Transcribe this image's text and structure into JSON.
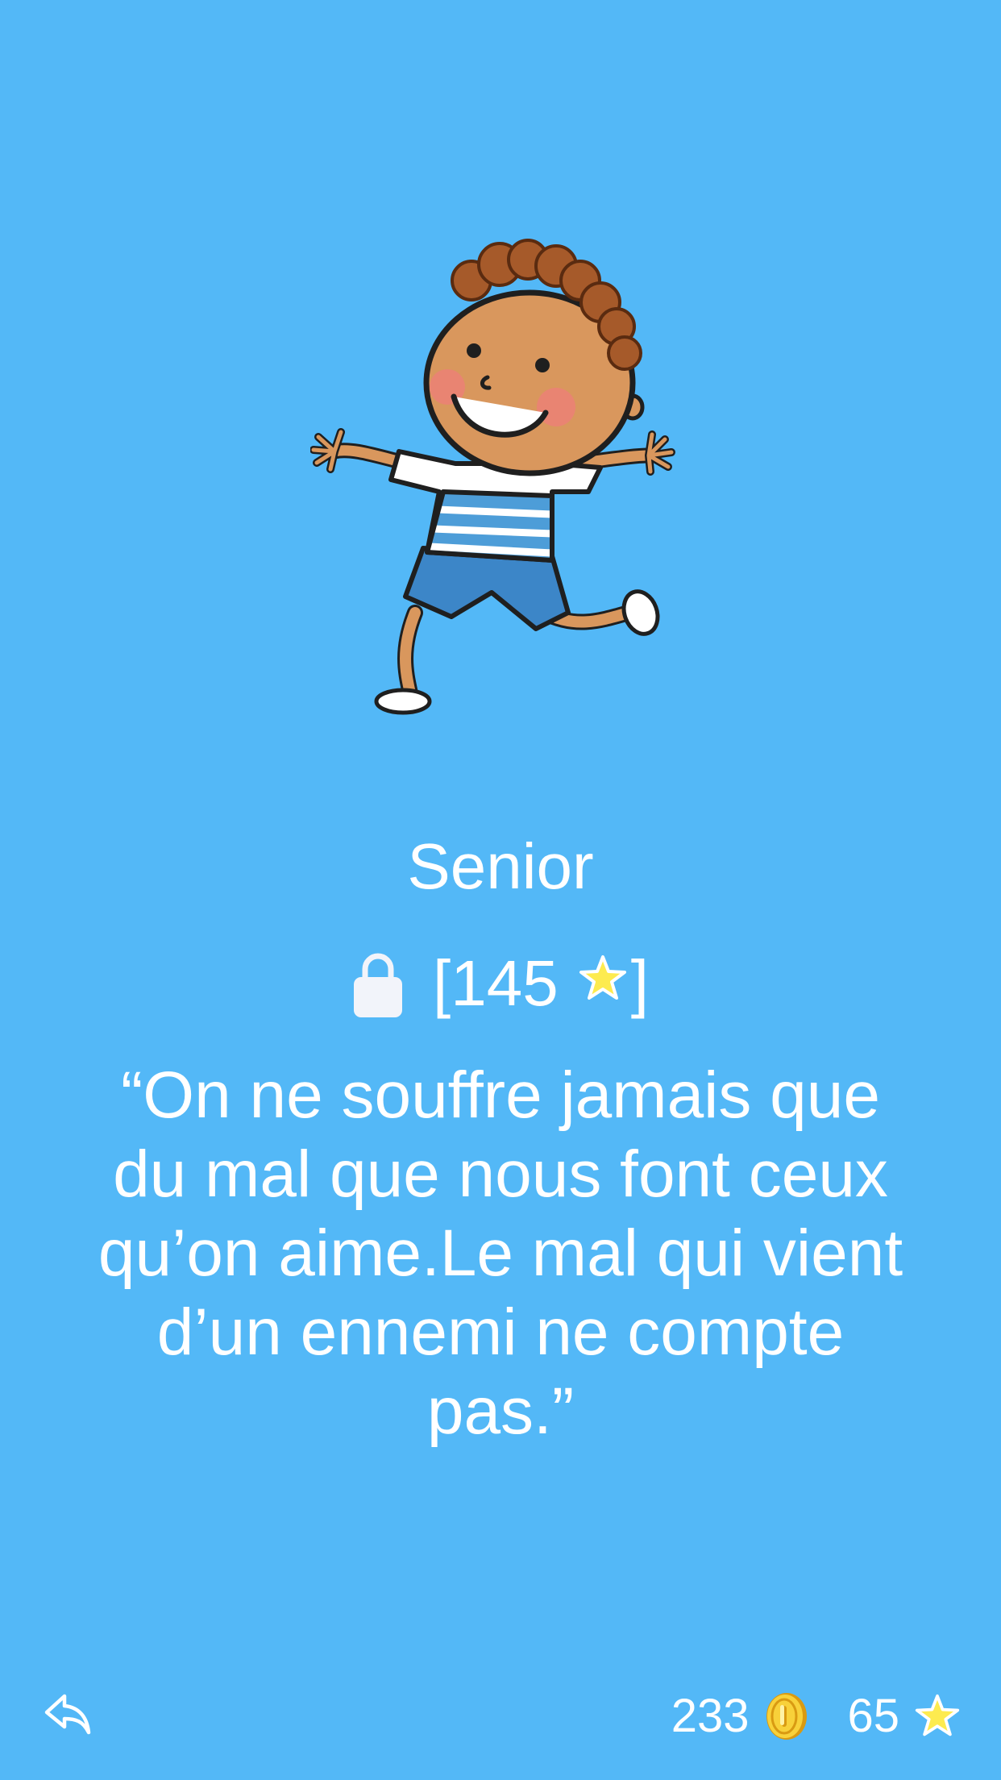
{
  "character": {
    "image": "running-boy-illustration",
    "title": "Senior"
  },
  "unlock": {
    "lock_icon": "lock-icon",
    "prefix": "[",
    "required": "145",
    "star_icon": "star-icon",
    "suffix": "]"
  },
  "quote": {
    "text": "“On ne souffre jamais que du mal que nous font ceux qu’on aime.Le mal qui vient d’un ennemi ne compte pas.”"
  },
  "footer": {
    "back_icon": "reply-arrow-icon",
    "coins": "233",
    "coin_icon": "gold-coin-icon",
    "stars": "65",
    "stars_icon": "star-icon"
  },
  "colors": {
    "background": "#53B8F7",
    "text": "#FFFFFF",
    "star": "#FDEB4F",
    "coin": "#F2B51C"
  }
}
